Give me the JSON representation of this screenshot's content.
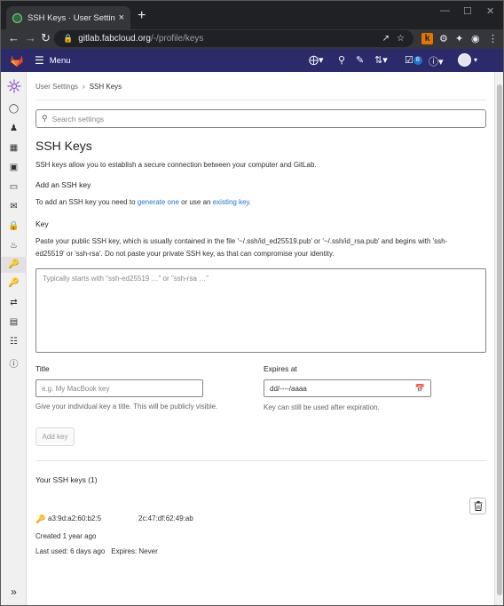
{
  "browser": {
    "tab_title": "SSH Keys · User Settings · GitLab",
    "tab_close": "×",
    "new_tab": "+",
    "url_host": "gitlab.fabcloud.org",
    "url_path": "/-/profile/keys"
  },
  "header": {
    "menu_label": "Menu",
    "todo_count": "8"
  },
  "breadcrumb": {
    "parent": "User Settings",
    "separator": "›",
    "current": "SSH Keys"
  },
  "search": {
    "placeholder": "Search settings"
  },
  "page": {
    "title": "SSH Keys",
    "intro": "SSH keys allow you to establish a secure connection between your computer and GitLab.",
    "add_heading": "Add an SSH key",
    "add_desc_prefix": "To add an SSH key you need to ",
    "generate_link": "generate one",
    "add_desc_middle": " or use an ",
    "existing_link": "existing key",
    "add_desc_suffix": ".",
    "key_label": "Key",
    "key_desc": "Paste your public SSH key, which is usually contained in the file '~/.ssh/id_ed25519.pub' or '~/.ssh/id_rsa.pub' and begins with 'ssh-ed25519' or 'ssh-rsa'. Do not paste your private SSH key, as that can compromise your identity.",
    "key_placeholder": "Typically starts with \"ssh-ed25519 …\" or \"ssh-rsa …\"",
    "title_label": "Title",
    "title_placeholder": "e.g. My MacBook key",
    "title_hint": "Give your individual key a title. This will be publicly visible.",
    "expires_label": "Expires at",
    "expires_placeholder": "dd/----/aaaa",
    "expires_hint": "Key can still be used after expiration.",
    "add_button": "Add key",
    "your_keys_heading": "Your SSH keys (1)"
  },
  "keys": [
    {
      "fingerprint_part1": "a3:9d:a2:60:b2:5",
      "fingerprint_part2": "2c:47:df:62:49:ab",
      "created": "Created 1 year ago",
      "last_used": "Last used: 6 days ago",
      "expires": "Expires: Never"
    }
  ],
  "colors": {
    "header_bg": "#2b2a6a",
    "link": "#1f75cb",
    "browser_dark": "#202124"
  }
}
